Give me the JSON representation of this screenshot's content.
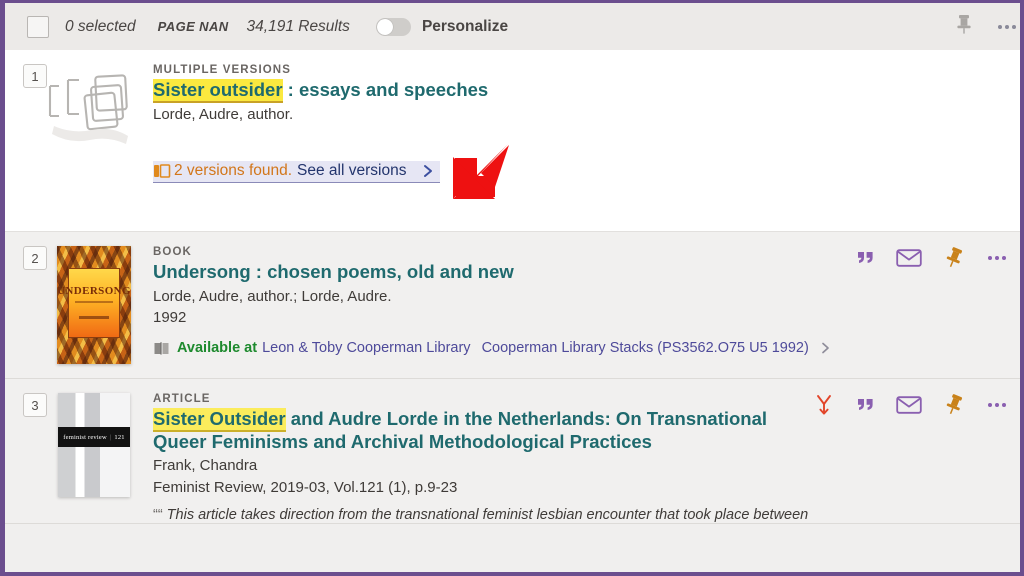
{
  "header": {
    "checkbox_checked": false,
    "selected_label": "0 selected",
    "page_label": "PAGE NAN",
    "results_label": "34,191 Results",
    "personalize_label": "Personalize",
    "personalize_on": false,
    "pin_icon": "pin-icon",
    "more_icon": "more-options-icon"
  },
  "results": [
    {
      "rank": "1",
      "type": "MULTIPLE VERSIONS",
      "title_highlight": "Sister outsider",
      "title_rest": " : essays and speeches",
      "author": "Lorde, Audre, author.",
      "versions_icon": "multiple-versions-icon",
      "versions_text": "2 versions found.",
      "versions_link": "See all versions",
      "chevron_icon": "chevron-right-icon",
      "thumbnail": "multiple-versions-placeholder"
    },
    {
      "rank": "2",
      "type": "BOOK",
      "title": "Undersong : chosen poems, old and new",
      "author": "Lorde, Audre, author.; Lorde, Audre.",
      "year": "1992",
      "availability_icon": "book-icon",
      "availability_status": "Available at",
      "availability_library": "Leon & Toby Cooperman Library",
      "availability_location": "Cooperman Library Stacks (PS3562.O75 U5 1992)",
      "chevron_icon": "chevron-right-icon",
      "thumbnail": "undersong-book-cover",
      "cover_title": "UNDERSONG",
      "actions": [
        "quote-icon",
        "email-icon",
        "pin-icon",
        "more-options-icon"
      ]
    },
    {
      "rank": "3",
      "type": "ARTICLE",
      "title_highlight": "Sister Outsider",
      "title_rest": " and Audre Lorde in the Netherlands: On Transnational Queer Feminisms and Archival Methodological Practices",
      "author": "Frank, Chandra",
      "source": "Feminist Review, 2019-03, Vol.121 (1), p.9-23",
      "snippet_quote_icon": "quote-icon",
      "snippet": "This article takes direction from the transnational feminist lesbian encounter that took place between",
      "thumbnail": "feminist-review-cover",
      "cover_title": "feminist review",
      "cover_issue": "121",
      "actions": [
        "fulltext-icon",
        "quote-icon",
        "email-icon",
        "pin-icon",
        "more-options-icon"
      ]
    }
  ],
  "annotation": {
    "arrow_icon": "red-arrow-down-left",
    "color": "#ee1111"
  },
  "colors": {
    "frame": "#6b4e8e",
    "title": "#1f6a6e",
    "highlight": "#fbe93f",
    "orange": "#d2761a",
    "link_blue": "#23356d",
    "available_green": "#1e8a2e",
    "location_purple": "#4e4a9a",
    "icon_purple": "#8a5fb0",
    "pin_gold": "#c9821a",
    "page_bg": "#f1f0ef",
    "active_bg": "#ffffff"
  }
}
